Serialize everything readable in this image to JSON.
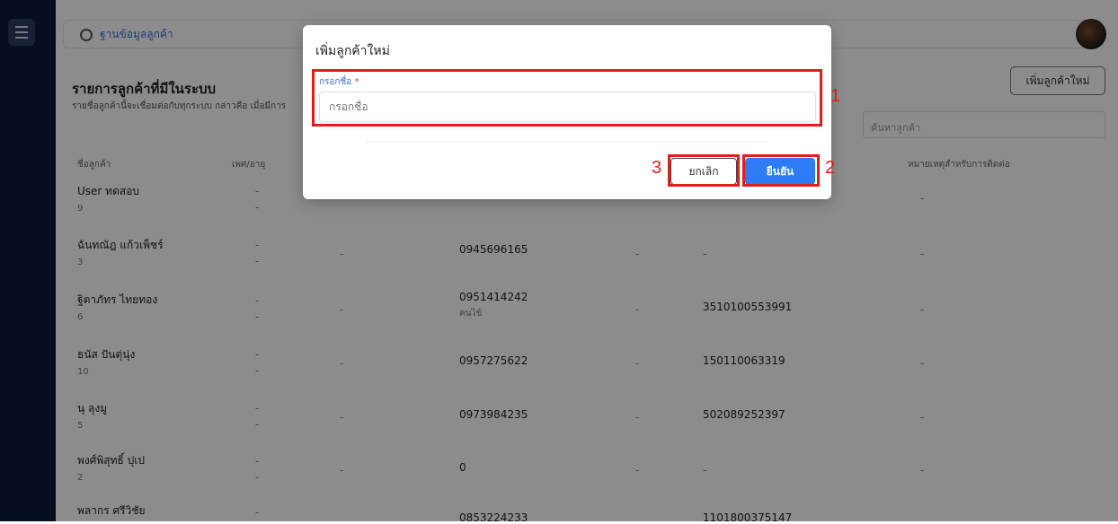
{
  "breadcrumb": "ฐานข้อมูลลูกค้า",
  "list": {
    "title": "รายการลูกค้าที่มีในระบบ",
    "description": "รายชื่อลูกค้านี้จะเชื่อมต่อกับทุกระบบ กล่าวคือ เมื่อมีการ",
    "add_button": "เพิ่มลูกค้าใหม่",
    "search_placeholder": "ค้นหาลูกค้า"
  },
  "table": {
    "headers": [
      "ชื่อลูกค้า",
      "เพศ/อายุ",
      "หมายเหตุสำหรับการติดต่อ"
    ],
    "rows": [
      {
        "name": "User ทดสอบ",
        "id": "9",
        "phone": "",
        "phone_note": "",
        "ref": "",
        "note": "-"
      },
      {
        "name": "ฉันทณัฎ แก้วเพ็ชร์",
        "id": "3",
        "phone": "0945696165",
        "phone_note": "",
        "ref": "-",
        "note": "-"
      },
      {
        "name": "ฐิตาภัทร ไทยทอง",
        "id": "6",
        "phone": "0951414242",
        "phone_note": "คนไข้",
        "ref": "3510100553991",
        "note": "-"
      },
      {
        "name": "ธนัส ปันตุ่นุ่ง",
        "id": "10",
        "phone": "0957275622",
        "phone_note": "",
        "ref": "150110063319",
        "note": "-"
      },
      {
        "name": "นุ ลุงมู",
        "id": "5",
        "phone": "0973984235",
        "phone_note": "",
        "ref": "502089252397",
        "note": "-"
      },
      {
        "name": "พงศ์พิสุทธิ์ ปุเป",
        "id": "2",
        "phone": "0",
        "phone_note": "",
        "ref": "-",
        "note": "-"
      },
      {
        "name": "พลากร ศรีวิชัย",
        "id": "",
        "phone": "0853224233",
        "phone_note": "",
        "ref": "1101800375147",
        "note": ""
      }
    ],
    "dash": "-"
  },
  "dialog": {
    "title": "เพิ่มลูกค้าใหม่",
    "field_label": "กรอกชื่อ",
    "required_mark": "*",
    "field_placeholder": "กรอกชื่อ",
    "cancel": "ยกเลิก",
    "confirm": "ยืนยัน"
  },
  "annotations": [
    "1",
    "2",
    "3"
  ],
  "colors": {
    "highlight": "#e21b1b",
    "primary": "#2e7cf6",
    "sidebar": "#0d1b3d"
  }
}
